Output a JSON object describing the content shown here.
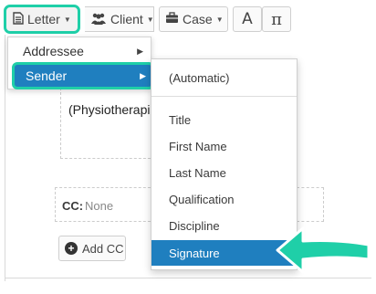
{
  "toolbar": {
    "letter_label": "Letter",
    "client_label": "Client",
    "case_label": "Case",
    "font_glyph": "A",
    "symbol_glyph": "π"
  },
  "document": {
    "address_text": "(Physiotherapis",
    "cc_label": "CC:",
    "cc_value": "None",
    "add_cc_label": "Add CC"
  },
  "menu": {
    "items": [
      {
        "label": "Addressee"
      },
      {
        "label": "Sender",
        "selected": true
      }
    ]
  },
  "submenu": {
    "automatic": "(Automatic)",
    "items": [
      {
        "label": "Title"
      },
      {
        "label": "First Name"
      },
      {
        "label": "Last Name"
      },
      {
        "label": "Qualification"
      },
      {
        "label": "Discipline"
      },
      {
        "label": "Signature",
        "selected": true
      }
    ]
  },
  "colors": {
    "highlight": "#1fcfa8",
    "selection": "#1f7fbf"
  }
}
